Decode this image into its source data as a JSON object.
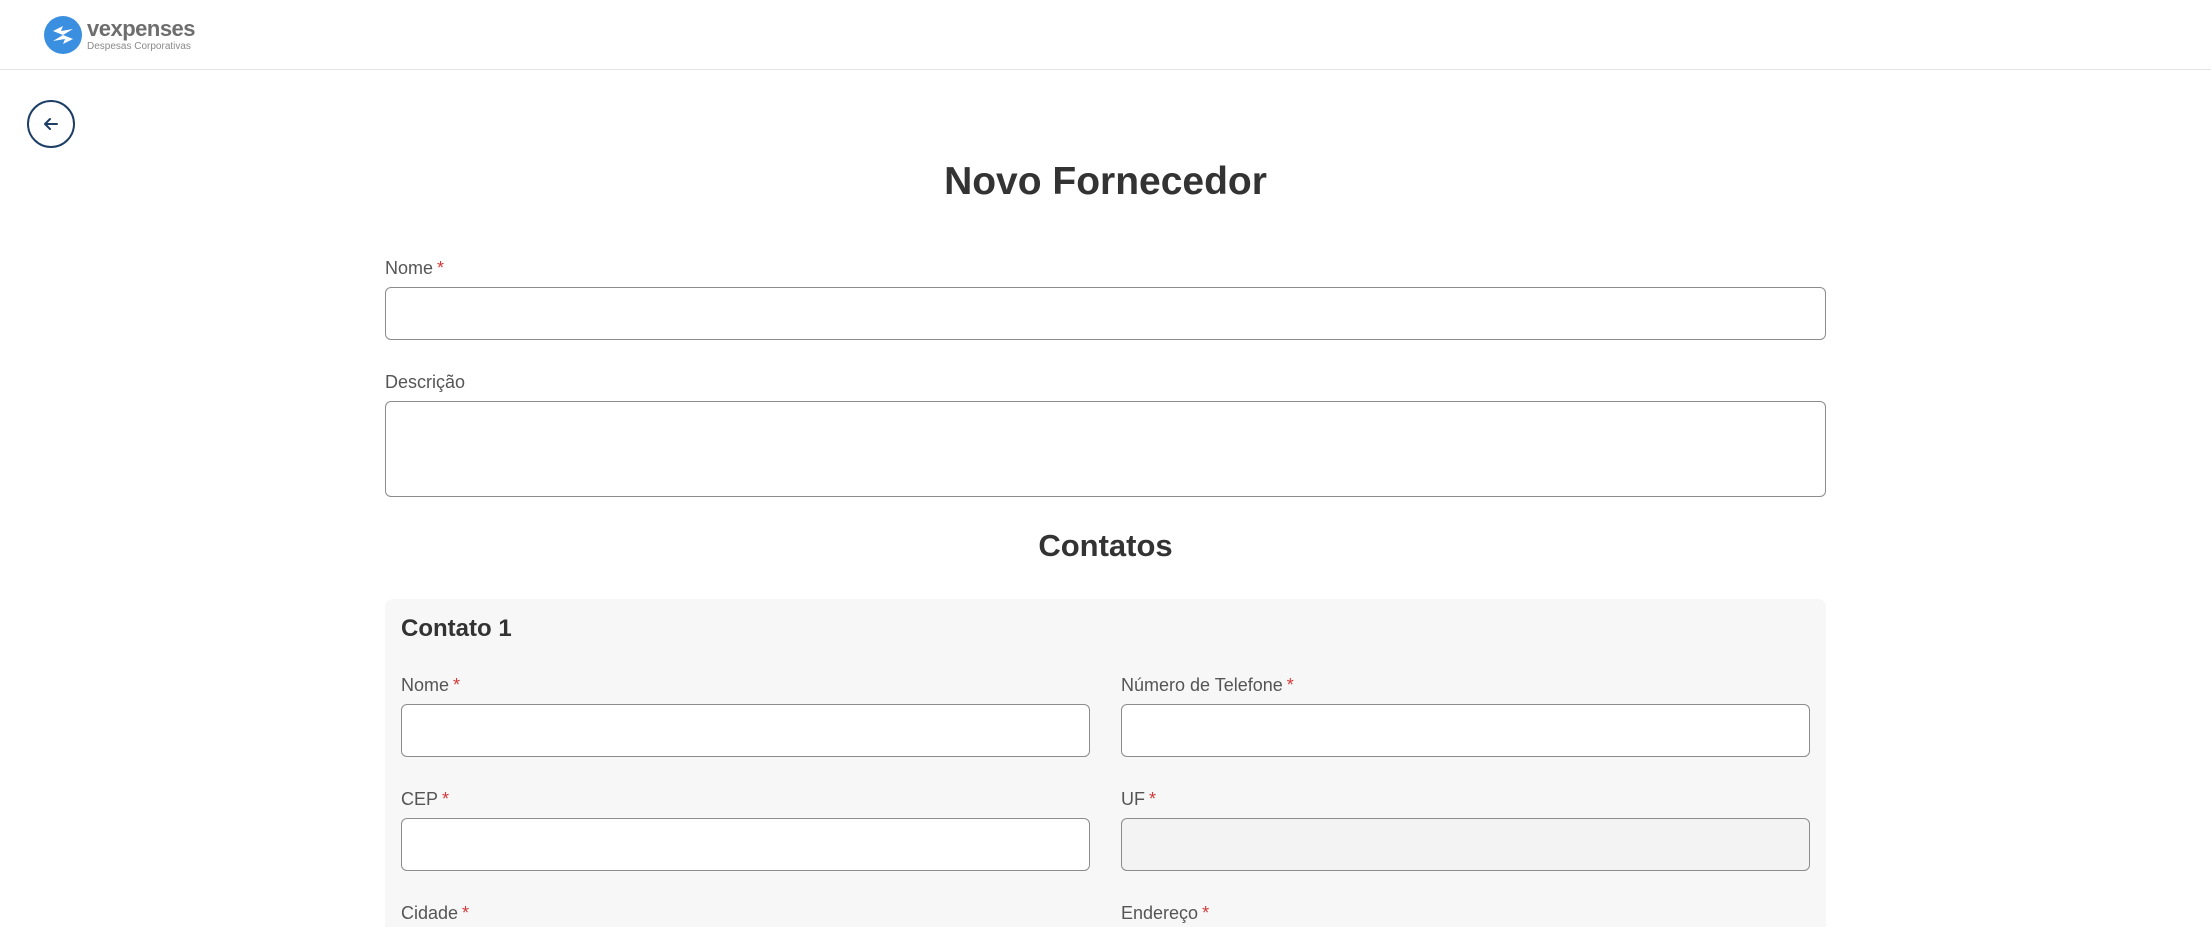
{
  "brand": {
    "name": "vexpenses",
    "tagline": "Despesas Corporativas",
    "accent": "#3a8fe0"
  },
  "nav": {
    "back_icon": "arrow-left-icon"
  },
  "page": {
    "title": "Novo Fornecedor"
  },
  "form": {
    "nome": {
      "label": "Nome",
      "required": "*",
      "value": ""
    },
    "descricao": {
      "label": "Descrição",
      "value": ""
    }
  },
  "contacts": {
    "section_title": "Contatos",
    "items": [
      {
        "title": "Contato 1",
        "nome": {
          "label": "Nome",
          "required": "*",
          "value": ""
        },
        "telefone": {
          "label": "Número de Telefone",
          "required": "*",
          "value": ""
        },
        "cep": {
          "label": "CEP",
          "required": "*",
          "value": ""
        },
        "uf": {
          "label": "UF",
          "required": "*",
          "value": ""
        },
        "cidade": {
          "label": "Cidade",
          "required": "*"
        },
        "endereco": {
          "label": "Endereço",
          "required": "*"
        }
      }
    ]
  },
  "colors": {
    "required": "#d23a3a",
    "back_border": "#1d3f66",
    "card_bg": "#f7f7f7"
  }
}
